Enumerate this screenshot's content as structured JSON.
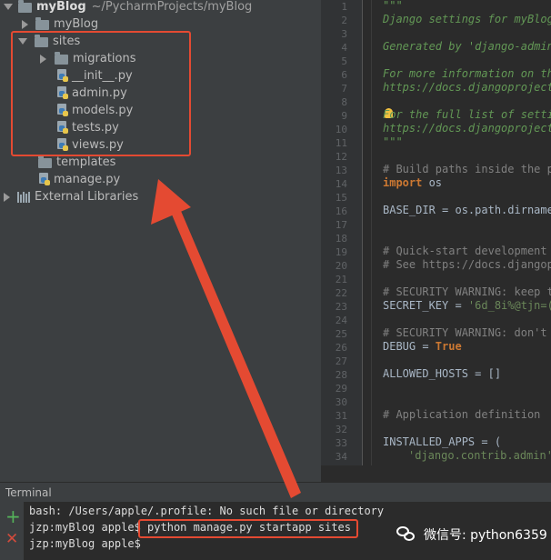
{
  "project_tree": {
    "root": {
      "name": "myBlog",
      "path": "~/PycharmProjects/myBlog"
    },
    "items": [
      {
        "label": "myBlog",
        "kind": "folder",
        "expanded": false
      },
      {
        "label": "sites",
        "kind": "folder",
        "expanded": true
      },
      {
        "label": "migrations",
        "kind": "folder",
        "expanded": false
      },
      {
        "label": "__init__.py",
        "kind": "py"
      },
      {
        "label": "admin.py",
        "kind": "py"
      },
      {
        "label": "models.py",
        "kind": "py"
      },
      {
        "label": "tests.py",
        "kind": "py"
      },
      {
        "label": "views.py",
        "kind": "py"
      },
      {
        "label": "templates",
        "kind": "folder"
      },
      {
        "label": "manage.py",
        "kind": "py"
      },
      {
        "label": "External Libraries",
        "kind": "libs"
      }
    ]
  },
  "editor": {
    "line_numbers": [
      "1",
      "2",
      "3",
      "4",
      "5",
      "6",
      "7",
      "8",
      "9",
      "10",
      "11",
      "12",
      "13",
      "14",
      "15",
      "16",
      "17",
      "18",
      "19",
      "20",
      "21",
      "22",
      "23",
      "24",
      "25",
      "26",
      "27",
      "28",
      "29",
      "30",
      "31",
      "32",
      "33",
      "34"
    ],
    "lines": {
      "l1": "\"\"\"",
      "l2": "Django settings for myBlog",
      "l4": "Generated by 'django-admin",
      "l6": "For more information on thi",
      "l7": "https://docs.djangoproject.",
      "l9": "For the full list of settin",
      "l10": "https://docs.djangoproject.",
      "l11": "\"\"\"",
      "l13": "# Build paths inside the pr",
      "l14_kw": "import",
      "l14_rest": " os",
      "l16": "BASE_DIR = os.path.dirname(",
      "l19": "# Quick-start development s",
      "l20": "# See https://docs.djangopr",
      "l22": "# SECURITY WARNING: keep th",
      "l23_a": "SECRET_KEY = ",
      "l23_s": "'6d_8i%@tjn=(",
      "l25": "# SECURITY WARNING: don't r",
      "l26_a": "DEBUG = ",
      "l26_kw": "True",
      "l28": "ALLOWED_HOSTS = []",
      "l31": "# Application definition",
      "l33": "INSTALLED_APPS = (",
      "l34_s": "'django.contrib.admin',"
    }
  },
  "terminal": {
    "title": "Terminal",
    "line1": "bash: /Users/apple/.profile: No such file or directory",
    "prompt": "jzp:myBlog apple$ ",
    "command": "python manage.py startapp sites",
    "line3": "jzp:myBlog apple$"
  },
  "watermark": {
    "text": "微信号: python6359"
  },
  "colors": {
    "annotation": "#e44a32",
    "background": "#2b2b2b",
    "panel": "#3c3f41"
  }
}
